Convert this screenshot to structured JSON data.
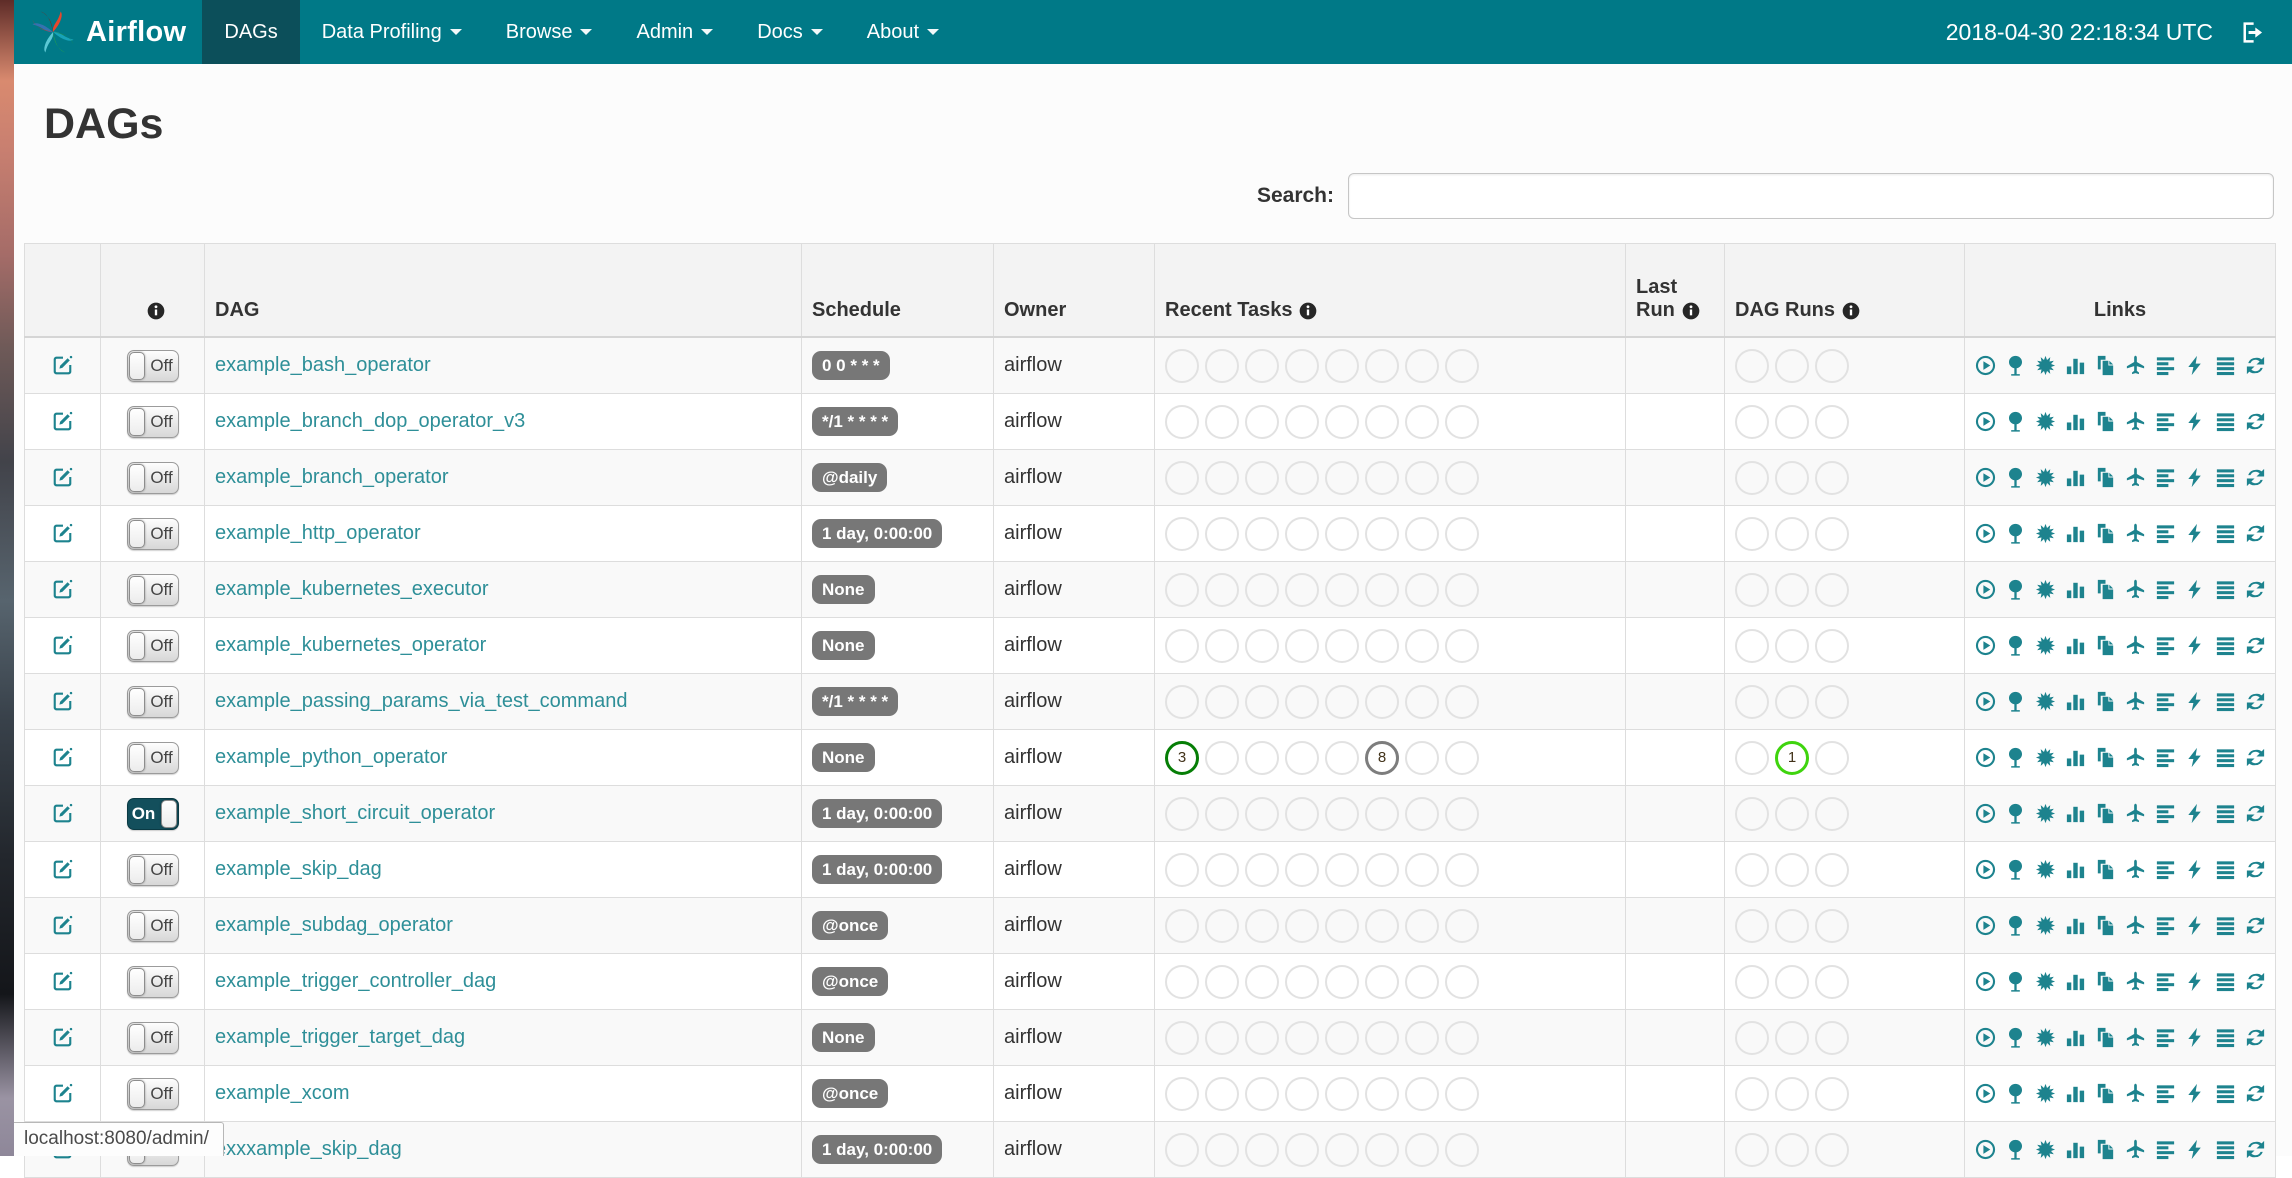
{
  "navbar": {
    "brand": "Airflow",
    "items": [
      {
        "label": "DAGs",
        "active": true,
        "caret": false
      },
      {
        "label": "Data Profiling",
        "active": false,
        "caret": true
      },
      {
        "label": "Browse",
        "active": false,
        "caret": true
      },
      {
        "label": "Admin",
        "active": false,
        "caret": true
      },
      {
        "label": "Docs",
        "active": false,
        "caret": true
      },
      {
        "label": "About",
        "active": false,
        "caret": true
      }
    ],
    "clock": "2018-04-30 22:18:34 UTC",
    "colors": {
      "bar": "#007987",
      "active_item": "#0c4f5a"
    }
  },
  "page": {
    "title": "DAGs",
    "search_label": "Search:",
    "search_value": ""
  },
  "table": {
    "headers": {
      "dag": "DAG",
      "schedule": "Schedule",
      "owner": "Owner",
      "recent_tasks": "Recent Tasks",
      "last_run": "Last Run",
      "dag_runs": "DAG Runs",
      "links": "Links"
    },
    "recent_task_slots": 8,
    "dag_run_slots": 3,
    "rows": [
      {
        "name": "example_bash_operator",
        "schedule": "0 0 * * *",
        "owner": "airflow",
        "toggle": "Off",
        "last_run": "",
        "recent": [],
        "runs": []
      },
      {
        "name": "example_branch_dop_operator_v3",
        "schedule": "*/1 * * * *",
        "owner": "airflow",
        "toggle": "Off",
        "last_run": "",
        "recent": [],
        "runs": []
      },
      {
        "name": "example_branch_operator",
        "schedule": "@daily",
        "owner": "airflow",
        "toggle": "Off",
        "last_run": "",
        "recent": [],
        "runs": []
      },
      {
        "name": "example_http_operator",
        "schedule": "1 day, 0:00:00",
        "owner": "airflow",
        "toggle": "Off",
        "last_run": "",
        "recent": [],
        "runs": []
      },
      {
        "name": "example_kubernetes_executor",
        "schedule": "None",
        "owner": "airflow",
        "toggle": "Off",
        "last_run": "",
        "recent": [],
        "runs": []
      },
      {
        "name": "example_kubernetes_operator",
        "schedule": "None",
        "owner": "airflow",
        "toggle": "Off",
        "last_run": "",
        "recent": [],
        "runs": []
      },
      {
        "name": "example_passing_params_via_test_command",
        "schedule": "*/1 * * * *",
        "owner": "airflow",
        "toggle": "Off",
        "last_run": "",
        "recent": [],
        "runs": []
      },
      {
        "name": "example_python_operator",
        "schedule": "None",
        "owner": "airflow",
        "toggle": "Off",
        "last_run": "",
        "recent": [
          {
            "i": 0,
            "n": "3",
            "c": "#067e06"
          },
          {
            "i": 5,
            "n": "8",
            "c": "#7d7d7d"
          }
        ],
        "runs": [
          {
            "i": 1,
            "n": "1",
            "c": "#3fd40e"
          }
        ]
      },
      {
        "name": "example_short_circuit_operator",
        "schedule": "1 day, 0:00:00",
        "owner": "airflow",
        "toggle": "On",
        "last_run": "",
        "recent": [],
        "runs": []
      },
      {
        "name": "example_skip_dag",
        "schedule": "1 day, 0:00:00",
        "owner": "airflow",
        "toggle": "Off",
        "last_run": "",
        "recent": [],
        "runs": []
      },
      {
        "name": "example_subdag_operator",
        "schedule": "@once",
        "owner": "airflow",
        "toggle": "Off",
        "last_run": "",
        "recent": [],
        "runs": []
      },
      {
        "name": "example_trigger_controller_dag",
        "schedule": "@once",
        "owner": "airflow",
        "toggle": "Off",
        "last_run": "",
        "recent": [],
        "runs": []
      },
      {
        "name": "example_trigger_target_dag",
        "schedule": "None",
        "owner": "airflow",
        "toggle": "Off",
        "last_run": "",
        "recent": [],
        "runs": []
      },
      {
        "name": "example_xcom",
        "schedule": "@once",
        "owner": "airflow",
        "toggle": "Off",
        "last_run": "",
        "recent": [],
        "runs": []
      },
      {
        "name": "exxxample_skip_dag",
        "schedule": "1 day, 0:00:00",
        "owner": "airflow",
        "toggle": "Off",
        "last_run": "",
        "recent": [],
        "runs": []
      }
    ]
  },
  "links": {
    "icons": [
      "trigger-dag",
      "tree-view",
      "graph-view",
      "tasks-duration",
      "task-tries",
      "landing-times",
      "gantt-view",
      "code-view",
      "dag-details",
      "refresh"
    ]
  },
  "status_colors": {
    "success": "#067e06",
    "queued": "#7d7d7d",
    "running": "#3fd40e",
    "empty": "#e2e2e2"
  },
  "statusbar": {
    "url": "localhost:8080/admin/"
  }
}
